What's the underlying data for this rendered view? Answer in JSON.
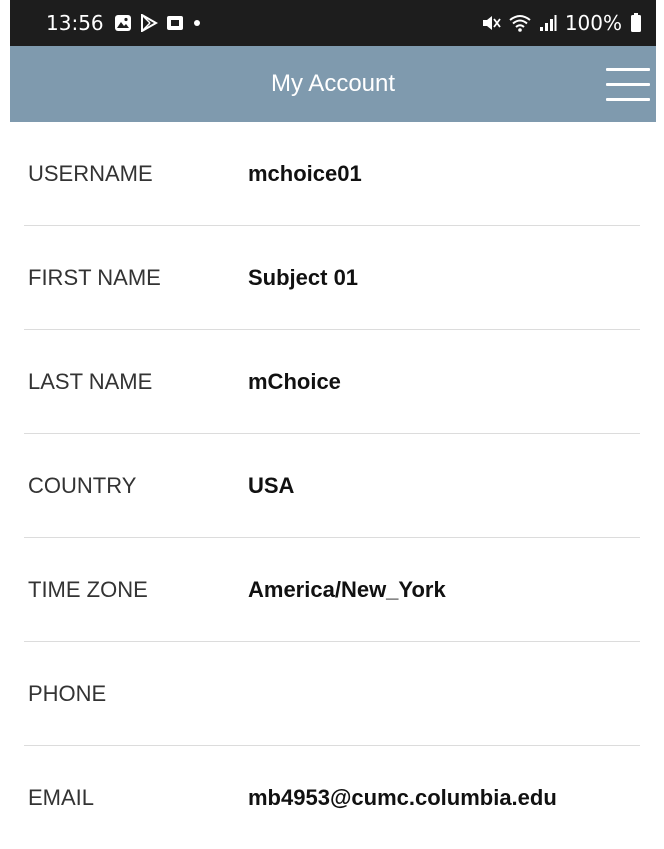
{
  "status_bar": {
    "time": "13:56",
    "battery": "100%",
    "left_icons": [
      "gallery-icon",
      "play-store-icon",
      "app-icon",
      "dot-icon"
    ],
    "right_icons": [
      "mute-icon",
      "wifi-icon",
      "signal-icon",
      "battery-icon"
    ]
  },
  "header": {
    "title": "My Account",
    "background": "#7f9aae"
  },
  "account": {
    "rows": [
      {
        "label": "USERNAME",
        "value": "mchoice01"
      },
      {
        "label": "FIRST NAME",
        "value": "Subject 01"
      },
      {
        "label": "LAST NAME",
        "value": "mChoice"
      },
      {
        "label": "COUNTRY",
        "value": "USA"
      },
      {
        "label": "TIME ZONE",
        "value": "America/New_York"
      },
      {
        "label": "PHONE",
        "value": ""
      },
      {
        "label": "EMAIL",
        "value": "mb4953@cumc.columbia.edu"
      }
    ]
  }
}
